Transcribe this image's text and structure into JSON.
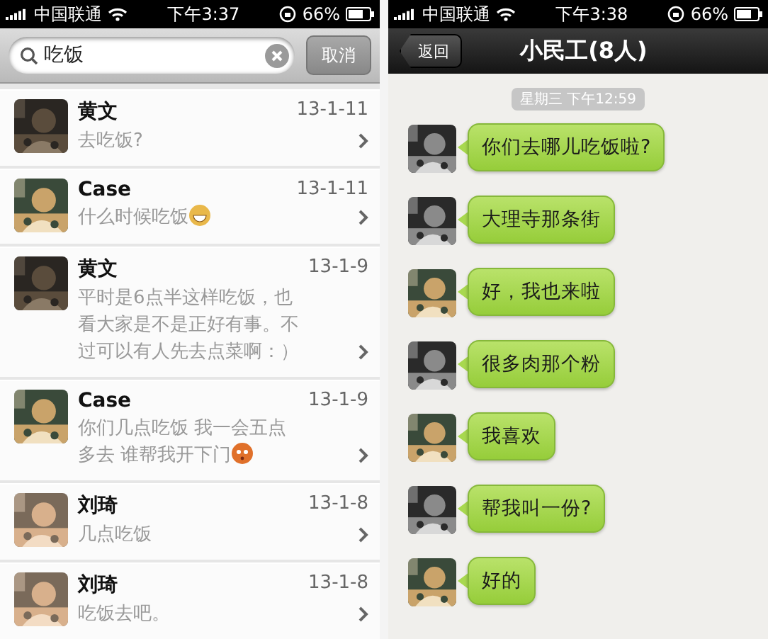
{
  "search_screen": {
    "status_bar": {
      "carrier": "中国联通",
      "time": "下午3:37",
      "battery": "66%"
    },
    "search": {
      "value": "吃饭",
      "cancel": "取消"
    },
    "results": [
      {
        "name": "黄文",
        "date": "13-1-11",
        "preview": "去吃饭?"
      },
      {
        "name": "Case",
        "date": "13-1-11",
        "preview": "什么时候吃饭",
        "emoji": {
          "kind": "grin"
        }
      },
      {
        "name": "黄文",
        "date": "13-1-9",
        "preview": "平时是6点半这样吃饭，也看大家是不是正好有事。不过可以有人先去点菜啊：）"
      },
      {
        "name": "Case",
        "date": "13-1-9",
        "preview": "你们几点吃饭 我一会五点多去 谁帮我开下门",
        "emoji": {
          "kind": "blush"
        }
      },
      {
        "name": "刘琦",
        "date": "13-1-8",
        "preview": "几点吃饭"
      },
      {
        "name": "刘琦",
        "date": "13-1-8",
        "preview": "吃饭去吧。"
      }
    ]
  },
  "chat_screen": {
    "status_bar": {
      "carrier": "中国联通",
      "time": "下午3:38",
      "battery": "66%"
    },
    "back": "返回",
    "title": "小民工(8人)",
    "timestamp": "星期三 下午12:59",
    "messages": [
      {
        "text": "你们去哪儿吃饭啦?"
      },
      {
        "text": "大理寺那条街"
      },
      {
        "text": "好，我也来啦"
      },
      {
        "text": "很多肉那个粉"
      },
      {
        "text": "我喜欢"
      },
      {
        "text": "帮我叫一份?"
      },
      {
        "text": "好的"
      }
    ]
  }
}
